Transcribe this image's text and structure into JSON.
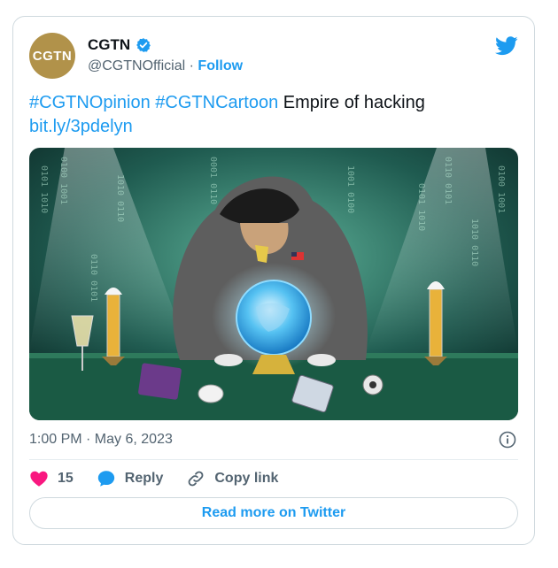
{
  "account": {
    "avatar_text": "CGTN",
    "name": "CGTN",
    "handle": "@CGTNOfficial",
    "separator": "·",
    "follow_label": "Follow",
    "verified": true
  },
  "tweet": {
    "hashtag1": "#CGTNOpinion",
    "hashtag2": "#CGTNCartoon",
    "text": "Empire of hacking",
    "link": "bit.ly/3pdelyn",
    "media_caption": "Cartoon of a hooded hacker at a desk with a glowing crystal ball",
    "media_binary": [
      "0101 1010",
      "0100 1001",
      "0110 0101",
      "1010 0110",
      "0001 0110",
      "1001 0100"
    ]
  },
  "meta": {
    "timestamp": "1:00 PM · May 6, 2023"
  },
  "actions": {
    "like_count": "15",
    "reply_label": "Reply",
    "copy_label": "Copy link",
    "read_more_label": "Read more on Twitter"
  },
  "colors": {
    "brand": "#1d9bf0",
    "like": "#f91880",
    "avatar_bg": "#b1924a"
  },
  "icons": [
    "verified-badge-icon",
    "twitter-bird-icon",
    "info-icon",
    "heart-icon",
    "reply-bubble-icon",
    "link-icon"
  ]
}
